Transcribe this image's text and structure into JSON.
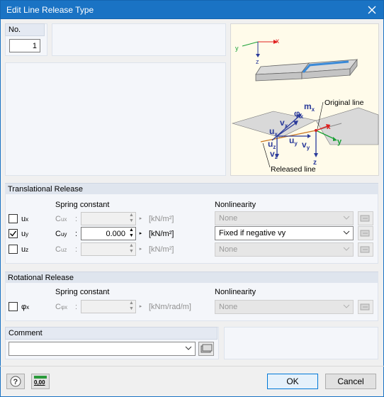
{
  "window": {
    "title": "Edit Line Release Type"
  },
  "number": {
    "label": "No.",
    "value": "1"
  },
  "diagram": {
    "axis_x": "x",
    "axis_y": "y",
    "axis_z": "z",
    "label_original": "Original line",
    "label_released": "Released line",
    "label_mx": "m",
    "sub_mx": "x",
    "label_phix": "φ",
    "sub_phix": "x",
    "label_ux": "u",
    "sub_ux": "x",
    "label_vx": "v",
    "sub_vx": "x",
    "label_uy": "u",
    "sub_uy": "y",
    "label_vy": "v",
    "sub_vy": "y",
    "label_uz": "u",
    "sub_uz": "z",
    "label_vz": "v",
    "sub_vz": "z"
  },
  "translational": {
    "header": "Translational Release",
    "col_spring": "Spring constant",
    "col_nonlinearity": "Nonlinearity",
    "rows": [
      {
        "name": "u",
        "sub": "x",
        "spring_name": "C",
        "spring_sub": "ux",
        "colon": ":",
        "value": "",
        "unit": "[kN/m²]",
        "nonlin": "None",
        "checked": false
      },
      {
        "name": "u",
        "sub": "y",
        "spring_name": "C",
        "spring_sub": "uy",
        "colon": ":",
        "value": "0.000",
        "unit": "[kN/m²]",
        "nonlin": "Fixed if negative vy",
        "checked": true
      },
      {
        "name": "u",
        "sub": "z",
        "spring_name": "C",
        "spring_sub": "uz",
        "colon": ":",
        "value": "",
        "unit": "[kN/m²]",
        "nonlin": "None",
        "checked": false
      }
    ]
  },
  "rotational": {
    "header": "Rotational Release",
    "col_spring": "Spring constant",
    "col_nonlinearity": "Nonlinearity",
    "row": {
      "name": "φ",
      "sub": "x",
      "spring_name": "C",
      "spring_sub": "φx",
      "colon": ":",
      "value": "",
      "unit": "[kNm/rad/m]",
      "nonlin": "None",
      "checked": false
    }
  },
  "comment": {
    "label": "Comment",
    "value": ""
  },
  "buttons": {
    "ok": "OK",
    "cancel": "Cancel",
    "units": "0,00"
  },
  "colors": {
    "titlebar": "#1a73c4",
    "accent_red": "#e02020",
    "accent_green": "#1aa035",
    "accent_blue": "#2a3a9a"
  }
}
